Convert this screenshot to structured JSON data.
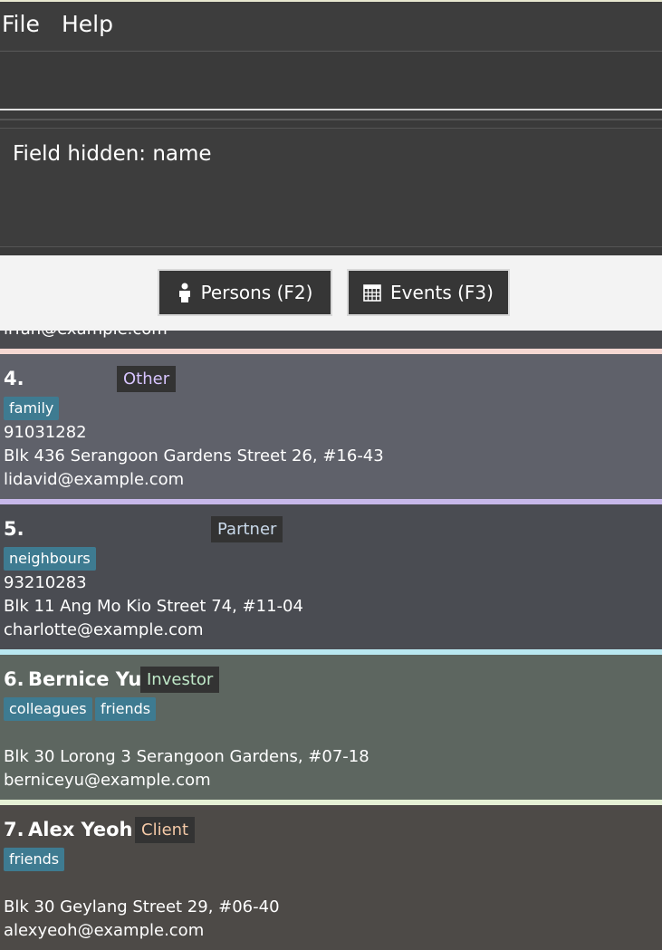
{
  "menu": {
    "file": "File",
    "help": "Help"
  },
  "command_box": {
    "value": ""
  },
  "result": {
    "text": "Field hidden: name"
  },
  "tabs": [
    {
      "label": "Persons (F2)",
      "icon": "person-icon"
    },
    {
      "label": "Events (F3)",
      "icon": "calendar-icon"
    }
  ],
  "partial_card": {
    "email": "irfan@example.com"
  },
  "persons": [
    {
      "index": "4.",
      "name": "",
      "relationship": "Other",
      "tags": [
        "family"
      ],
      "phone": "91031282",
      "address": "Blk 436 Serangoon Gardens Street 26, #16-43",
      "email": "lidavid@example.com",
      "bg": "#5f616a",
      "accent": "#c7b8ea",
      "badge_color": "#d7c4ff"
    },
    {
      "index": "5.",
      "name": "",
      "relationship": "Partner",
      "tags": [
        "neighbours"
      ],
      "phone": "93210283",
      "address": "Blk 11 Ang Mo Kio Street 74, #11-04",
      "email": "charlotte@example.com",
      "bg": "#4a4c52",
      "accent": "#b9e7f0",
      "badge_color": "#c9d9ea"
    },
    {
      "index": "6.",
      "name": "Bernice Yu",
      "relationship": "Investor",
      "tags": [
        "colleagues",
        "friends"
      ],
      "phone": "",
      "address": "Blk 30 Lorong 3 Serangoon Gardens, #07-18",
      "email": "berniceyu@example.com",
      "bg": "#5d6660",
      "accent": "#e4f0d4",
      "badge_color": "#bfe8c8"
    },
    {
      "index": "7.",
      "name": "Alex Yeoh",
      "relationship": "Client",
      "tags": [
        "friends"
      ],
      "phone": "",
      "address": "Blk 30 Geylang Street 29, #06-40",
      "email": "alexyeoh@example.com",
      "bg": "#4d4a47",
      "accent": "#4d4a47",
      "badge_color": "#f3c8a6"
    }
  ]
}
